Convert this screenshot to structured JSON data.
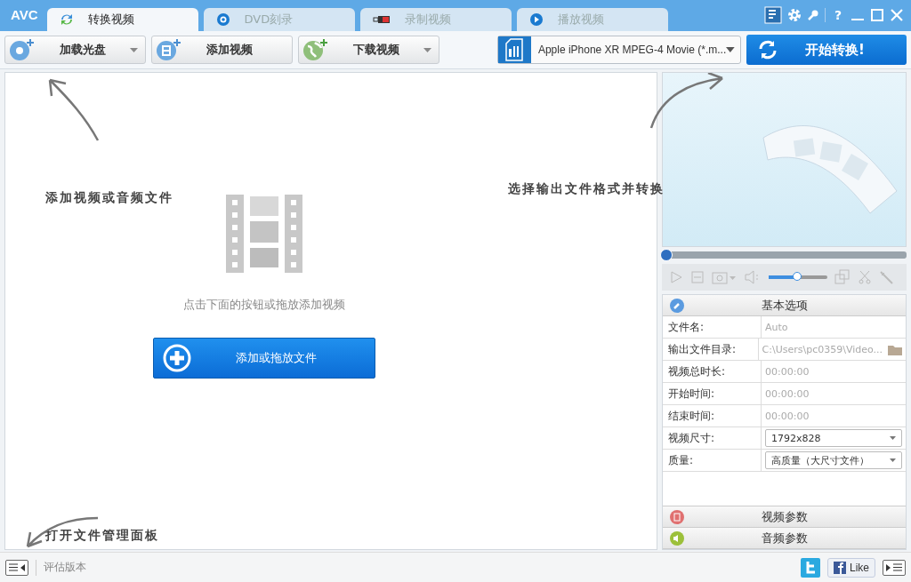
{
  "app": {
    "logo": "AVC",
    "help": "?"
  },
  "tabs": [
    {
      "label": "转换视频",
      "selected": true
    },
    {
      "label": "DVD刻录",
      "selected": false
    },
    {
      "label": "录制视频",
      "selected": false
    },
    {
      "label": "播放视频",
      "selected": false
    }
  ],
  "toolbar": {
    "buttons": [
      {
        "label": "加载光盘",
        "dropdown": true
      },
      {
        "label": "添加视频",
        "dropdown": false
      },
      {
        "label": "下载视频",
        "dropdown": true
      }
    ],
    "format": "Apple iPhone XR MPEG-4 Movie (*.m...",
    "start": "开始转换!"
  },
  "workspace": {
    "hints": [
      "添加视频或音频文件",
      "选择输出文件格式并转换",
      "打开文件管理面板"
    ],
    "message": "点击下面的按钮或拖放添加视频",
    "add_button": "添加或拖放文件"
  },
  "player": {
    "seek": {
      "level": 0
    },
    "volume": {
      "level": 0.48
    }
  },
  "options": {
    "title": "基本选项",
    "rows": [
      {
        "label": "文件名:",
        "value": "Auto",
        "kind": "text"
      },
      {
        "label": "输出文件目录:",
        "value": "C:\\Users\\pc0359\\Video...",
        "kind": "folder"
      },
      {
        "label": "视频总时长:",
        "value": "00:00:00",
        "kind": "text"
      },
      {
        "label": "开始时间:",
        "value": "00:00:00",
        "kind": "text"
      },
      {
        "label": "结束时间:",
        "value": "00:00:00",
        "kind": "text"
      },
      {
        "label": "视频尺寸:",
        "value": "1792x828",
        "kind": "select"
      },
      {
        "label": "质量:",
        "value": "高质量（大尺寸文件）",
        "kind": "select"
      }
    ],
    "sections": [
      "视频参数",
      "音频参数"
    ]
  },
  "status": {
    "edition": "评估版本",
    "like": "Like"
  }
}
